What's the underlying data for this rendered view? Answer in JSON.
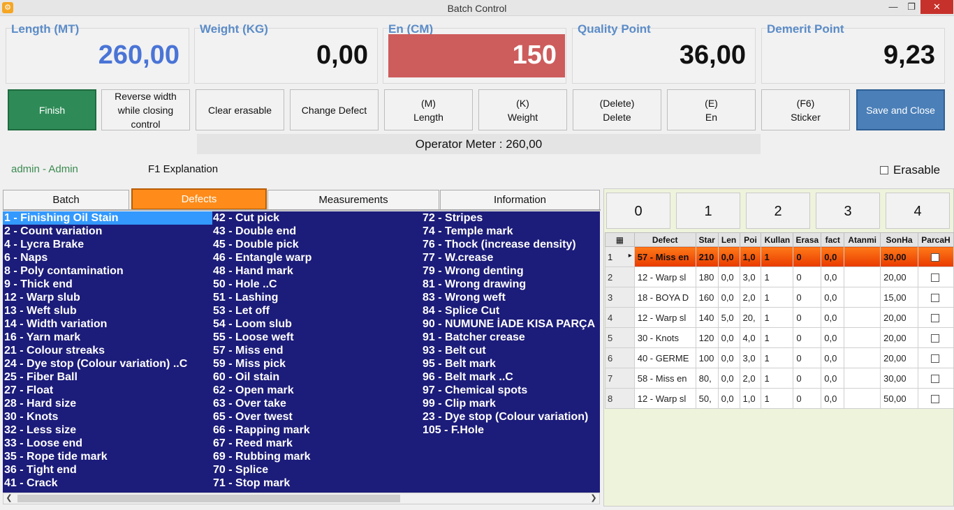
{
  "window": {
    "title": "Batch Control",
    "min": "—",
    "max": "❐",
    "close": "✕"
  },
  "metrics": [
    {
      "label": "Length (MT)",
      "value": "260,00"
    },
    {
      "label": "Weight (KG)",
      "value": "0,00"
    },
    {
      "label": "En (CM)",
      "value": "150"
    },
    {
      "label": "Quality Point",
      "value": "36,00"
    },
    {
      "label": "Demerit Point",
      "value": "9,23"
    }
  ],
  "buttons": [
    {
      "label": "Finish"
    },
    {
      "label": "Reverse width\nwhile closing\ncontrol"
    },
    {
      "label": "Clear erasable"
    },
    {
      "label": "Change Defect"
    },
    {
      "label": "(M)\nLength"
    },
    {
      "label": "(K)\nWeight"
    },
    {
      "label": "(Delete)\nDelete"
    },
    {
      "label": "(E)\nEn"
    },
    {
      "label": "(F6)\nSticker"
    },
    {
      "label": "Save and Close"
    }
  ],
  "operator_meter": "Operator Meter : 260,00",
  "user": "admin - Admin",
  "f1_label": "F1 Explanation",
  "erasable_label": "Erasable",
  "tabs": [
    "Batch",
    "Defects",
    "Measurements",
    "Information"
  ],
  "defect_columns": [
    [
      "1 - Finishing Oil Stain",
      "2 - Count variation",
      "4 - Lycra Brake",
      "6 - Naps",
      "8 - Poly contamination",
      "9 - Thick end",
      "12 - Warp slub",
      "13 - Weft slub",
      "14 - Width  variation",
      "16 - Yarn mark",
      "21 - Colour streaks",
      "24 - Dye stop (Colour variation) ..C",
      "25 - Fiber Ball",
      "27 - Float",
      "28 - Hard size",
      "30 - Knots",
      "32 - Less size",
      "33 - Loose end",
      "35 - Rope tide mark",
      "36 - Tight end",
      "41 - Crack"
    ],
    [
      "42 - Cut pick",
      "43 - Double end",
      "45 - Double pick",
      "46 - Entangle  warp",
      "48 - Hand mark",
      "50 - Hole ..C",
      "51 - Lashing",
      "53 - Let off",
      "54 - Loom slub",
      "55 - Loose weft",
      "57 - Miss end",
      "59 - Miss pick",
      "60 - Oil stain",
      "62 - Open mark",
      "63 - Over take",
      "65 - Over twest",
      "66 - Rapping mark",
      "67 - Reed mark",
      "69 - Rubbing mark",
      "70 - Splice",
      "71 - Stop mark"
    ],
    [
      "72 - Stripes",
      "74 - Temple mark",
      "76 - Thock (increase density)",
      "77 - W.crease",
      "79 - Wrong denting",
      "81 - Wrong drawing",
      "83 - Wrong weft",
      "84 - Splice Cut",
      "90 - NUMUNE İADE KISA PARÇA",
      "91 - Batcher crease",
      "93 - Belt cut",
      "95 - Belt mark",
      "96 - Belt mark ..C",
      "97 - Chemical spots",
      "99 - Clip mark",
      "23 - Dye stop (Colour variation)",
      "105 - F.Hole"
    ]
  ],
  "num_buttons": [
    "0",
    "1",
    "2",
    "3",
    "4"
  ],
  "grid": {
    "corner_icon": "grid-settings-icon",
    "headers": [
      "Defect",
      "Star",
      "Len",
      "Poi",
      "Kullan",
      "Erasa",
      "fact",
      "Atanmi",
      "SonHa",
      "ParcaH"
    ],
    "rows": [
      {
        "n": "1",
        "marker": "▸",
        "cells": [
          "57 - Miss en",
          "210",
          "0,0",
          "1,0",
          "1",
          "0",
          "0,0",
          "",
          "30,00"
        ]
      },
      {
        "n": "2",
        "marker": "",
        "cells": [
          "12 - Warp sl",
          "180",
          "0,0",
          "3,0",
          "1",
          "0",
          "0,0",
          "",
          "20,00"
        ]
      },
      {
        "n": "3",
        "marker": "",
        "cells": [
          "18 - BOYA D",
          "160",
          "0,0",
          "2,0",
          "1",
          "0",
          "0,0",
          "",
          "15,00"
        ]
      },
      {
        "n": "4",
        "marker": "",
        "cells": [
          "12 - Warp sl",
          "140",
          "5,0",
          "20,",
          "1",
          "0",
          "0,0",
          "",
          "20,00"
        ]
      },
      {
        "n": "5",
        "marker": "",
        "cells": [
          "30 - Knots",
          "120",
          "0,0",
          "4,0",
          "1",
          "0",
          "0,0",
          "",
          "20,00"
        ]
      },
      {
        "n": "6",
        "marker": "",
        "cells": [
          "40 - GERME",
          "100",
          "0,0",
          "3,0",
          "1",
          "0",
          "0,0",
          "",
          "20,00"
        ]
      },
      {
        "n": "7",
        "marker": "",
        "cells": [
          "58 - Miss en",
          "80,",
          "0,0",
          "2,0",
          "1",
          "0",
          "0,0",
          "",
          "30,00"
        ]
      },
      {
        "n": "8",
        "marker": "",
        "cells": [
          "12 - Warp sl",
          "50,",
          "0,0",
          "1,0",
          "1",
          "0",
          "0,0",
          "",
          "50,00"
        ]
      }
    ]
  },
  "colors": {
    "accent_tab": "#ff8c1a",
    "finish": "#2e8b57",
    "save": "#4a7fb8",
    "en_box": "#cd5c5c",
    "list_bg": "#1c1c7a",
    "selected_row": "#ff4500"
  }
}
